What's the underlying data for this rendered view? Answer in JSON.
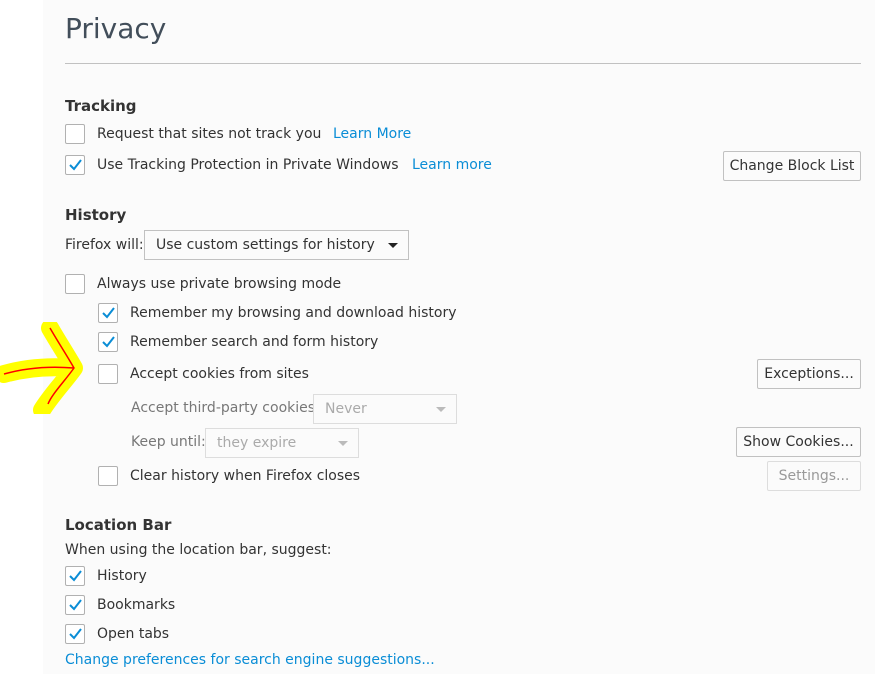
{
  "title": "Privacy",
  "tracking": {
    "heading": "Tracking",
    "dnt": {
      "label": "Request that sites not track you",
      "checked": false,
      "link": "Learn More"
    },
    "tp": {
      "label": "Use Tracking Protection in Private Windows",
      "checked": true,
      "link": "Learn more"
    },
    "change_block_list": "Change Block List"
  },
  "history": {
    "heading": "History",
    "firefox_will_label": "Firefox will:",
    "firefox_will_value": "Use custom settings for history",
    "always_private": {
      "label": "Always use private browsing mode",
      "checked": false
    },
    "remember_browsing": {
      "label": "Remember my browsing and download history",
      "checked": true
    },
    "remember_search": {
      "label": "Remember search and form history",
      "checked": true
    },
    "accept_cookies": {
      "label": "Accept cookies from sites",
      "checked": false
    },
    "exceptions": "Exceptions...",
    "third_party_label": "Accept third-party cookies:",
    "third_party_value": "Never",
    "keep_until_label": "Keep until:",
    "keep_until_value": "they expire",
    "show_cookies": "Show Cookies...",
    "clear_history": {
      "label": "Clear history when Firefox closes",
      "checked": false
    },
    "settings": "Settings..."
  },
  "location_bar": {
    "heading": "Location Bar",
    "suggest_label": "When using the location bar, suggest:",
    "history": {
      "label": "History",
      "checked": true
    },
    "bookmarks": {
      "label": "Bookmarks",
      "checked": true
    },
    "open_tabs": {
      "label": "Open tabs",
      "checked": true
    },
    "search_link": "Change preferences for search engine suggestions..."
  },
  "colors": {
    "accent": "#0a8dd6",
    "annotation_arrow": "#ff0000",
    "annotation_highlight": "#ffff00"
  }
}
